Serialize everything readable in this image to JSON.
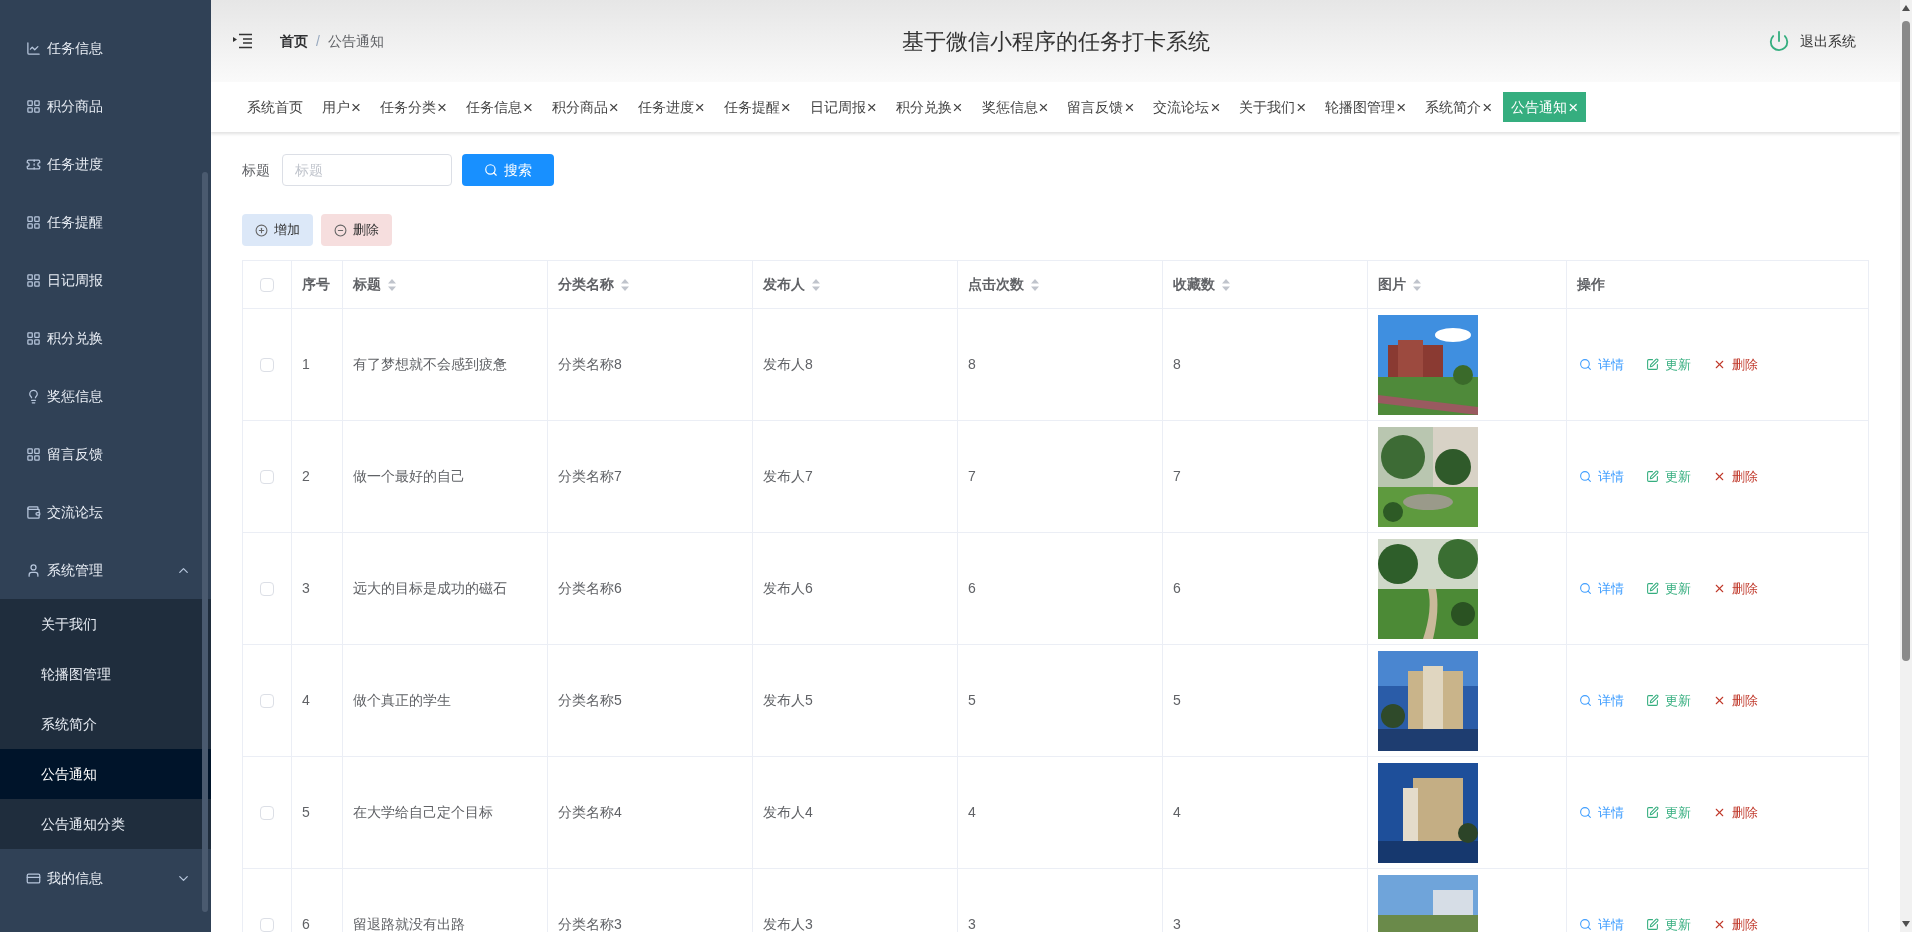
{
  "sidebar": {
    "items": [
      {
        "label": "任务信息",
        "selected": false
      },
      {
        "label": "积分商品",
        "selected": false
      },
      {
        "label": "任务进度",
        "selected": false
      },
      {
        "label": "任务提醒",
        "selected": false
      },
      {
        "label": "日记周报",
        "selected": false
      },
      {
        "label": "积分兑换",
        "selected": false
      },
      {
        "label": "奖惩信息",
        "selected": false
      },
      {
        "label": "留言反馈",
        "selected": false
      },
      {
        "label": "交流论坛",
        "selected": false
      },
      {
        "label": "系统管理",
        "expanded": true,
        "children": [
          {
            "label": "关于我们",
            "selected": false
          },
          {
            "label": "轮播图管理",
            "selected": false
          },
          {
            "label": "系统简介",
            "selected": false
          },
          {
            "label": "公告通知",
            "selected": true
          },
          {
            "label": "公告通知分类",
            "selected": false
          }
        ]
      },
      {
        "label": "我的信息",
        "expanded": false
      }
    ]
  },
  "header": {
    "breadcrumb": [
      "首页",
      "公告通知"
    ],
    "breadcrumb_separator": "/",
    "title": "基于微信小程序的任务打卡系统",
    "logout": "退出系统"
  },
  "tabs": [
    {
      "label": "系统首页",
      "closable": false,
      "selected": false
    },
    {
      "label": "用户",
      "closable": true,
      "selected": false
    },
    {
      "label": "任务分类",
      "closable": true,
      "selected": false
    },
    {
      "label": "任务信息",
      "closable": true,
      "selected": false
    },
    {
      "label": "积分商品",
      "closable": true,
      "selected": false
    },
    {
      "label": "任务进度",
      "closable": true,
      "selected": false
    },
    {
      "label": "任务提醒",
      "closable": true,
      "selected": false
    },
    {
      "label": "日记周报",
      "closable": true,
      "selected": false
    },
    {
      "label": "积分兑换",
      "closable": true,
      "selected": false
    },
    {
      "label": "奖惩信息",
      "closable": true,
      "selected": false
    },
    {
      "label": "留言反馈",
      "closable": true,
      "selected": false
    },
    {
      "label": "交流论坛",
      "closable": true,
      "selected": false
    },
    {
      "label": "关于我们",
      "closable": true,
      "selected": false
    },
    {
      "label": "轮播图管理",
      "closable": true,
      "selected": false
    },
    {
      "label": "系统简介",
      "closable": true,
      "selected": false
    },
    {
      "label": "公告通知",
      "closable": true,
      "selected": true
    }
  ],
  "close_mark": "×",
  "search": {
    "label": "标题",
    "placeholder": "标题",
    "button": "搜索"
  },
  "actions": {
    "add": "增加",
    "delete": "删除"
  },
  "table": {
    "header_checked": false,
    "columns": [
      {
        "label": "序号",
        "sortable": false
      },
      {
        "label": "标题",
        "sortable": true
      },
      {
        "label": "分类名称",
        "sortable": true
      },
      {
        "label": "发布人",
        "sortable": true
      },
      {
        "label": "点击次数",
        "sortable": true
      },
      {
        "label": "收藏数",
        "sortable": true
      },
      {
        "label": "图片",
        "sortable": true
      },
      {
        "label": "操作",
        "sortable": false
      }
    ],
    "rows": [
      {
        "checked": false,
        "index": "1",
        "title": "有了梦想就不会感到疲惫",
        "category": "分类名称8",
        "publisher": "发布人8",
        "clicks": "8",
        "favorites": "8",
        "actions": {
          "detail": "详情",
          "update": "更新",
          "delete": "删除"
        }
      },
      {
        "checked": false,
        "index": "2",
        "title": "做一个最好的自己",
        "category": "分类名称7",
        "publisher": "发布人7",
        "clicks": "7",
        "favorites": "7",
        "actions": {
          "detail": "详情",
          "update": "更新",
          "delete": "删除"
        }
      },
      {
        "checked": false,
        "index": "3",
        "title": "远大的目标是成功的磁石",
        "category": "分类名称6",
        "publisher": "发布人6",
        "clicks": "6",
        "favorites": "6",
        "actions": {
          "detail": "详情",
          "update": "更新",
          "delete": "删除"
        }
      },
      {
        "checked": false,
        "index": "4",
        "title": "做个真正的学生",
        "category": "分类名称5",
        "publisher": "发布人5",
        "clicks": "5",
        "favorites": "5",
        "actions": {
          "detail": "详情",
          "update": "更新",
          "delete": "删除"
        }
      },
      {
        "checked": false,
        "index": "5",
        "title": "在大学给自己定个目标",
        "category": "分类名称4",
        "publisher": "发布人4",
        "clicks": "4",
        "favorites": "4",
        "actions": {
          "detail": "详情",
          "update": "更新",
          "delete": "删除"
        }
      },
      {
        "checked": false,
        "index": "6",
        "title": "留退路就没有出路",
        "category": "分类名称3",
        "publisher": "发布人3",
        "clicks": "3",
        "favorites": "3",
        "actions": {
          "detail": "详情",
          "update": "更新",
          "delete": "删除"
        }
      }
    ]
  }
}
